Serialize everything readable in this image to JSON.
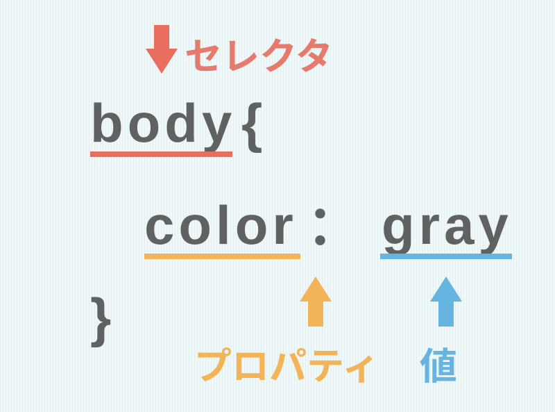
{
  "labels": {
    "selector": "セレクタ",
    "property": "プロパティ",
    "value": "値"
  },
  "code": {
    "selector": "body",
    "open_brace": "{",
    "property": "color",
    "colon": "：",
    "value": "gray",
    "close_brace": "}"
  },
  "colors": {
    "selector": "#ea6e5f",
    "property": "#f2b457",
    "value": "#66b4e0",
    "code_text": "#5f6163"
  }
}
